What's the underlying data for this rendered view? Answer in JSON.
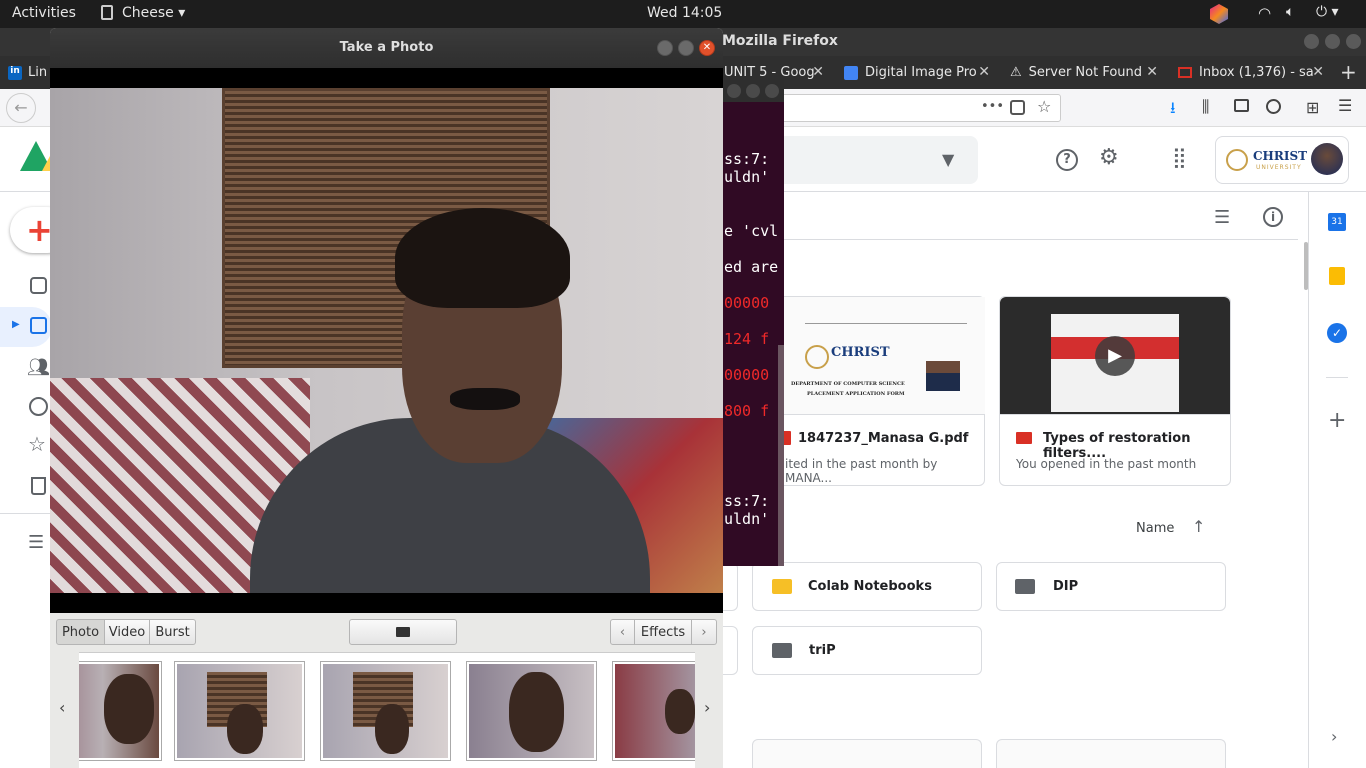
{
  "topbar": {
    "activities": "Activities",
    "app_name": "Cheese",
    "clock": "Wed 14:05"
  },
  "firefox": {
    "title": "Mozilla Firefox",
    "tabs": [
      {
        "label": "Lin"
      },
      {
        "label": "UNIT 5 - Goog"
      },
      {
        "label": "Digital Image Pro"
      },
      {
        "label": "Server Not Found"
      },
      {
        "label": "Inbox (1,376) - sa"
      }
    ],
    "url_menu": "•••"
  },
  "drive": {
    "org_name": "CHRIST",
    "org_sub": "UNIVERSITY",
    "sort_label": "Name",
    "files": [
      {
        "name": "1847237_Manasa G.pdf",
        "sub": "ited in the past month by MANA..."
      },
      {
        "name": "Types of restoration filters....",
        "sub": "You opened in the past month"
      }
    ],
    "pdf_preview": {
      "logo": "CHRIST",
      "dept": "DEPARTMENT OF COMPUTER SCIENCE",
      "form": "PLACEMENT APPLICATION FORM"
    },
    "folders": [
      {
        "name": "Colab Notebooks"
      },
      {
        "name": "DIP"
      },
      {
        "name": "triP"
      }
    ],
    "calendar_day": "31"
  },
  "terminal": {
    "lines": [
      {
        "text": "ss:7:",
        "color": "#ffffff"
      },
      {
        "text": "uldn'",
        "color": "#ffffff"
      },
      {
        "text": "e 'cvl",
        "color": "#ffffff"
      },
      {
        "text": "ed are",
        "color": "#ffffff"
      },
      {
        "text": "00000",
        "color": "#ef2929"
      },
      {
        "text": "124 f",
        "color": "#ef2929"
      },
      {
        "text": "00000",
        "color": "#ef2929"
      },
      {
        "text": "800 f",
        "color": "#ef2929"
      },
      {
        "text": "ss:7:",
        "color": "#ffffff"
      },
      {
        "text": "uldn'",
        "color": "#ffffff"
      }
    ]
  },
  "cheese": {
    "title": "Take a Photo",
    "modes": [
      {
        "label": "Photo"
      },
      {
        "label": "Video"
      },
      {
        "label": "Burst"
      }
    ],
    "effects_label": "Effects"
  },
  "colors": {
    "topbar": "#1d1d1d",
    "terminal": "#300a24",
    "accent_blue": "#1a73e8",
    "drive_red": "#d93025"
  }
}
